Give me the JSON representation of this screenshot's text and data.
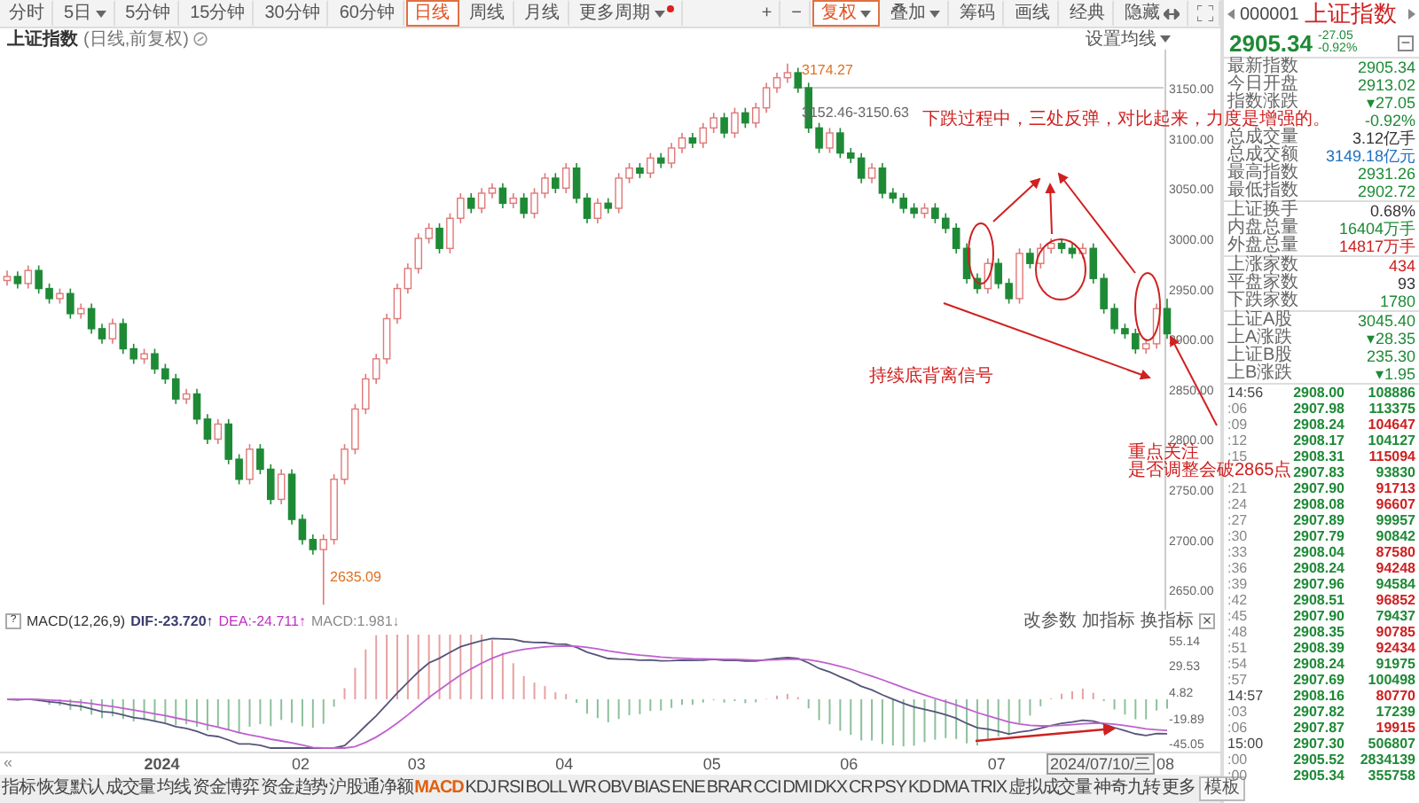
{
  "toolbar": {
    "periods": [
      {
        "label": "分时",
        "selected": false,
        "dropdown": false
      },
      {
        "label": "5日",
        "selected": false,
        "dropdown": true
      },
      {
        "label": "5分钟",
        "selected": false,
        "dropdown": false
      },
      {
        "label": "15分钟",
        "selected": false,
        "dropdown": false
      },
      {
        "label": "30分钟",
        "selected": false,
        "dropdown": false
      },
      {
        "label": "60分钟",
        "selected": false,
        "dropdown": false
      },
      {
        "label": "日线",
        "selected": true,
        "dropdown": false
      },
      {
        "label": "周线",
        "selected": false,
        "dropdown": false
      },
      {
        "label": "月线",
        "selected": false,
        "dropdown": false
      },
      {
        "label": "更多周期",
        "selected": false,
        "dropdown": true,
        "badge": true
      }
    ],
    "tools": [
      {
        "label": "+",
        "kind": "text",
        "selected": false
      },
      {
        "label": "−",
        "kind": "text",
        "selected": false
      },
      {
        "label": "复权",
        "kind": "dropdown",
        "selected": true
      },
      {
        "label": "叠加",
        "kind": "dropdown",
        "selected": false
      },
      {
        "label": "筹码",
        "kind": "text",
        "selected": false
      },
      {
        "label": "画线",
        "kind": "text",
        "selected": false
      },
      {
        "label": "经典",
        "kind": "text",
        "selected": false
      },
      {
        "label": "隐藏",
        "kind": "hide",
        "selected": false
      },
      {
        "kind": "fullscreen",
        "selected": false
      }
    ]
  },
  "chart": {
    "title": "上证指数",
    "subtitle": "(日线,前复权)",
    "ma_settings": "设置均线",
    "high_label": "3174.27",
    "range_label": "3152.46-3150.63",
    "low_label": "2635.09",
    "annotations": [
      "下跌过程中，三处反弹，对比起来，力度是增强的。",
      "持续底背离信号",
      "重点关注",
      "是否调整会破2865点"
    ],
    "chart_data": {
      "type": "candlestick",
      "ylim": [
        2630,
        3188
      ],
      "ohlc": [
        [
          2958,
          2968,
          2953,
          2962
        ],
        [
          2962,
          2967,
          2950,
          2955
        ],
        [
          2955,
          2973,
          2950,
          2968
        ],
        [
          2968,
          2973,
          2945,
          2950
        ],
        [
          2950,
          2955,
          2935,
          2940
        ],
        [
          2940,
          2950,
          2935,
          2945
        ],
        [
          2945,
          2950,
          2920,
          2925
        ],
        [
          2925,
          2935,
          2920,
          2930
        ],
        [
          2930,
          2935,
          2905,
          2910
        ],
        [
          2910,
          2915,
          2895,
          2900
        ],
        [
          2900,
          2920,
          2895,
          2915
        ],
        [
          2915,
          2920,
          2885,
          2890
        ],
        [
          2890,
          2895,
          2875,
          2880
        ],
        [
          2880,
          2890,
          2875,
          2885
        ],
        [
          2885,
          2890,
          2865,
          2870
        ],
        [
          2870,
          2875,
          2855,
          2860
        ],
        [
          2860,
          2865,
          2835,
          2840
        ],
        [
          2840,
          2850,
          2835,
          2845
        ],
        [
          2845,
          2850,
          2815,
          2820
        ],
        [
          2820,
          2825,
          2795,
          2800
        ],
        [
          2800,
          2820,
          2795,
          2815
        ],
        [
          2815,
          2820,
          2775,
          2780
        ],
        [
          2780,
          2785,
          2755,
          2760
        ],
        [
          2760,
          2795,
          2755,
          2790
        ],
        [
          2790,
          2795,
          2765,
          2770
        ],
        [
          2770,
          2775,
          2735,
          2740
        ],
        [
          2740,
          2770,
          2735,
          2765
        ],
        [
          2765,
          2770,
          2715,
          2720
        ],
        [
          2720,
          2725,
          2695,
          2700
        ],
        [
          2700,
          2705,
          2685,
          2690
        ],
        [
          2690,
          2705,
          2635,
          2700
        ],
        [
          2700,
          2765,
          2695,
          2760
        ],
        [
          2760,
          2795,
          2755,
          2790
        ],
        [
          2790,
          2835,
          2785,
          2830
        ],
        [
          2830,
          2865,
          2825,
          2860
        ],
        [
          2860,
          2885,
          2855,
          2880
        ],
        [
          2880,
          2925,
          2875,
          2920
        ],
        [
          2920,
          2955,
          2915,
          2950
        ],
        [
          2950,
          2975,
          2945,
          2970
        ],
        [
          2970,
          3005,
          2965,
          3000
        ],
        [
          3000,
          3015,
          2995,
          3010
        ],
        [
          3010,
          3015,
          2985,
          2990
        ],
        [
          2990,
          3025,
          2985,
          3020
        ],
        [
          3020,
          3045,
          3015,
          3040
        ],
        [
          3040,
          3045,
          3025,
          3030
        ],
        [
          3030,
          3050,
          3025,
          3045
        ],
        [
          3045,
          3055,
          3040,
          3050
        ],
        [
          3050,
          3055,
          3030,
          3035
        ],
        [
          3035,
          3045,
          3030,
          3040
        ],
        [
          3040,
          3045,
          3020,
          3025
        ],
        [
          3025,
          3050,
          3020,
          3045
        ],
        [
          3045,
          3065,
          3040,
          3060
        ],
        [
          3060,
          3065,
          3045,
          3050
        ],
        [
          3050,
          3075,
          3045,
          3070
        ],
        [
          3070,
          3075,
          3035,
          3040
        ],
        [
          3040,
          3045,
          3015,
          3020
        ],
        [
          3020,
          3040,
          3015,
          3035
        ],
        [
          3035,
          3040,
          3025,
          3030
        ],
        [
          3030,
          3065,
          3025,
          3060
        ],
        [
          3060,
          3075,
          3055,
          3070
        ],
        [
          3070,
          3075,
          3060,
          3065
        ],
        [
          3065,
          3085,
          3060,
          3080
        ],
        [
          3080,
          3085,
          3070,
          3075
        ],
        [
          3075,
          3095,
          3070,
          3090
        ],
        [
          3090,
          3105,
          3085,
          3100
        ],
        [
          3100,
          3105,
          3090,
          3095
        ],
        [
          3095,
          3115,
          3090,
          3110
        ],
        [
          3110,
          3125,
          3105,
          3120
        ],
        [
          3120,
          3125,
          3100,
          3105
        ],
        [
          3105,
          3130,
          3100,
          3125
        ],
        [
          3125,
          3130,
          3110,
          3115
        ],
        [
          3115,
          3135,
          3110,
          3130
        ],
        [
          3130,
          3155,
          3125,
          3150
        ],
        [
          3150,
          3165,
          3145,
          3160
        ],
        [
          3160,
          3174,
          3155,
          3165
        ],
        [
          3165,
          3170,
          3145,
          3150
        ],
        [
          3150,
          3155,
          3105,
          3110
        ],
        [
          3110,
          3115,
          3085,
          3090
        ],
        [
          3090,
          3110,
          3085,
          3105
        ],
        [
          3105,
          3110,
          3080,
          3085
        ],
        [
          3085,
          3090,
          3075,
          3080
        ],
        [
          3080,
          3085,
          3055,
          3060
        ],
        [
          3060,
          3075,
          3055,
          3070
        ],
        [
          3070,
          3075,
          3040,
          3045
        ],
        [
          3045,
          3050,
          3035,
          3040
        ],
        [
          3040,
          3045,
          3025,
          3030
        ],
        [
          3030,
          3035,
          3020,
          3025
        ],
        [
          3025,
          3035,
          3020,
          3030
        ],
        [
          3030,
          3035,
          3015,
          3020
        ],
        [
          3020,
          3025,
          3005,
          3010
        ],
        [
          3010,
          3015,
          2985,
          2990
        ],
        [
          2990,
          2995,
          2955,
          2960
        ],
        [
          2960,
          2965,
          2945,
          2950
        ],
        [
          2950,
          2980,
          2945,
          2975
        ],
        [
          2975,
          2980,
          2950,
          2955
        ],
        [
          2955,
          2960,
          2935,
          2940
        ],
        [
          2940,
          2990,
          2935,
          2985
        ],
        [
          2985,
          2990,
          2970,
          2975
        ],
        [
          2975,
          2995,
          2970,
          2990
        ],
        [
          2990,
          3000,
          2985,
          2995
        ],
        [
          2995,
          3000,
          2985,
          2990
        ],
        [
          2990,
          2995,
          2980,
          2985
        ],
        [
          2985,
          2995,
          2980,
          2990
        ],
        [
          2990,
          2995,
          2955,
          2960
        ],
        [
          2960,
          2965,
          2925,
          2930
        ],
        [
          2930,
          2935,
          2905,
          2910
        ],
        [
          2910,
          2915,
          2900,
          2905
        ],
        [
          2905,
          2910,
          2885,
          2890
        ],
        [
          2890,
          2900,
          2885,
          2895
        ],
        [
          2895,
          2935,
          2890,
          2930
        ],
        [
          2930,
          2940,
          2900,
          2905
        ]
      ],
      "yticks": [
        {
          "value": 3150,
          "label": "3150.00"
        },
        {
          "value": 3100,
          "label": "3100.00"
        },
        {
          "value": 3050,
          "label": "3050.00"
        },
        {
          "value": 3000,
          "label": "3000.00"
        },
        {
          "value": 2950,
          "label": "2950.00"
        },
        {
          "value": 2900,
          "label": "2900.00"
        },
        {
          "value": 2850,
          "label": "2850.00"
        },
        {
          "value": 2800,
          "label": "2800.00"
        },
        {
          "value": 2750,
          "label": "2750.00"
        },
        {
          "value": 2700,
          "label": "2700.00"
        },
        {
          "value": 2650,
          "label": "2650.00"
        }
      ]
    }
  },
  "macd": {
    "help": "?",
    "name": "MACD(12,26,9)",
    "dif": "DIF:-23.720↑",
    "dea": "DEA:-24.711↑",
    "value": "MACD:1.981↓",
    "actions": [
      "改参数",
      "加指标",
      "换指标"
    ],
    "close": "×",
    "yticks": [
      "55.14",
      "29.53",
      "4.82",
      "-19.89",
      "-45.05"
    ]
  },
  "axis": {
    "scroll": "«",
    "labels": [
      "2024",
      "02",
      "03",
      "04",
      "05",
      "06",
      "07",
      "08"
    ],
    "cursor": "2024/07/10/三"
  },
  "indicator_tabs": [
    {
      "label": "指标",
      "selected": false
    },
    {
      "label": "恢复默认",
      "selected": false
    },
    {
      "label": "成交量",
      "selected": false
    },
    {
      "label": "均线",
      "selected": false
    },
    {
      "label": "资金博弈",
      "selected": false
    },
    {
      "label": "资金趋势",
      "selected": false
    },
    {
      "label": "沪股通净额",
      "selected": false
    },
    {
      "label": "MACD",
      "selected": true
    },
    {
      "label": "KDJ",
      "selected": false
    },
    {
      "label": "RSI",
      "selected": false
    },
    {
      "label": "BOLL",
      "selected": false
    },
    {
      "label": "WR",
      "selected": false
    },
    {
      "label": "OBV",
      "selected": false
    },
    {
      "label": "BIAS",
      "selected": false
    },
    {
      "label": "ENE",
      "selected": false
    },
    {
      "label": "BRAR",
      "selected": false
    },
    {
      "label": "CCI",
      "selected": false
    },
    {
      "label": "DMI",
      "selected": false
    },
    {
      "label": "DKX",
      "selected": false
    },
    {
      "label": "CR",
      "selected": false
    },
    {
      "label": "PSY",
      "selected": false
    },
    {
      "label": "KD",
      "selected": false
    },
    {
      "label": "DMA",
      "selected": false
    },
    {
      "label": "TRIX",
      "selected": false
    },
    {
      "label": "虚拟成交量",
      "selected": false
    },
    {
      "label": "神奇九转",
      "selected": false
    },
    {
      "label": "更多",
      "selected": false
    }
  ],
  "template_button": "模板",
  "quote": {
    "code": "000001",
    "name": "上证指数",
    "price": "2905.34",
    "change": "-27.05",
    "change_pct": "-0.92%",
    "collapse": "−",
    "stats": [
      [
        {
          "label": "最新指数",
          "value": "2905.34",
          "color": "#1e8a36"
        },
        {
          "label": "今日开盘",
          "value": "2913.02",
          "color": "#1e8a36"
        },
        {
          "label": "指数涨跌",
          "value": "▾27.05",
          "color": "#1e8a36"
        },
        {
          "value": "-0.92%",
          "color": "#1e8a36"
        },
        {
          "label": "总成交量",
          "value": "3.12亿手",
          "color": "#333333"
        },
        {
          "label": "总成交额",
          "value": "3149.18亿元",
          "color": "#2070c0"
        },
        {
          "label": "最高指数",
          "value": "2931.26",
          "color": "#1e8a36"
        },
        {
          "label": "最低指数",
          "value": "2902.72",
          "color": "#1e8a36"
        }
      ],
      [
        {
          "label": "上证换手",
          "value": "0.68%",
          "color": "#333333"
        },
        {
          "label": "内盘总量",
          "value": "16404万手",
          "color": "#1e8a36"
        },
        {
          "label": "外盘总量",
          "value": "14817万手",
          "color": "#d02020"
        }
      ],
      [
        {
          "label": "上涨家数",
          "value": "434",
          "color": "#d02020"
        },
        {
          "label": "平盘家数",
          "value": "93",
          "color": "#333333"
        },
        {
          "label": "下跌家数",
          "value": "1780",
          "color": "#1e8a36"
        }
      ],
      [
        {
          "label": "上证A股",
          "value": "3045.40",
          "color": "#1e8a36"
        },
        {
          "label": "上A涨跌",
          "value": "▾28.35",
          "color": "#1e8a36"
        },
        {
          "label": "上证B股",
          "value": "235.30",
          "color": "#1e8a36"
        },
        {
          "label": "上B涨跌",
          "value": "▾1.95",
          "color": "#1e8a36"
        }
      ]
    ],
    "ticks": [
      {
        "time": "14:56",
        "price": "2908.00",
        "volume": "108886",
        "color": "#1e8a36"
      },
      {
        "time": ":06",
        "price": "2907.98",
        "volume": "113375",
        "color": "#1e8a36"
      },
      {
        "time": ":09",
        "price": "2908.24",
        "volume": "104647",
        "color": "#d02020"
      },
      {
        "time": ":12",
        "price": "2908.17",
        "volume": "104127",
        "color": "#1e8a36"
      },
      {
        "time": ":15",
        "price": "2908.31",
        "volume": "115094",
        "color": "#d02020"
      },
      {
        "price": "2907.83",
        "volume": "93830",
        "color": "#1e8a36"
      },
      {
        "time": ":21",
        "price": "2907.90",
        "volume": "91713",
        "color": "#d02020"
      },
      {
        "time": ":24",
        "price": "2908.08",
        "volume": "96607",
        "color": "#d02020"
      },
      {
        "time": ":27",
        "price": "2907.89",
        "volume": "99957",
        "color": "#1e8a36"
      },
      {
        "time": ":30",
        "price": "2907.79",
        "volume": "90842",
        "color": "#1e8a36"
      },
      {
        "time": ":33",
        "price": "2908.04",
        "volume": "87580",
        "color": "#d02020"
      },
      {
        "time": ":36",
        "price": "2908.24",
        "volume": "94248",
        "color": "#d02020"
      },
      {
        "time": ":39",
        "price": "2907.96",
        "volume": "94584",
        "color": "#1e8a36"
      },
      {
        "time": ":42",
        "price": "2908.51",
        "volume": "96852",
        "color": "#d02020"
      },
      {
        "time": ":45",
        "price": "2907.90",
        "volume": "79437",
        "color": "#1e8a36"
      },
      {
        "time": ":48",
        "price": "2908.35",
        "volume": "90785",
        "color": "#d02020"
      },
      {
        "time": ":51",
        "price": "2908.39",
        "volume": "92434",
        "color": "#d02020"
      },
      {
        "time": ":54",
        "price": "2908.24",
        "volume": "91975",
        "color": "#1e8a36"
      },
      {
        "time": ":57",
        "price": "2907.69",
        "volume": "100498",
        "color": "#1e8a36"
      },
      {
        "time": "14:57",
        "price": "2908.16",
        "volume": "80770",
        "color": "#d02020"
      },
      {
        "time": ":03",
        "price": "2907.82",
        "volume": "17239",
        "color": "#1e8a36"
      },
      {
        "time": ":06",
        "price": "2907.87",
        "volume": "19915",
        "color": "#d02020"
      },
      {
        "time": "15:00",
        "price": "2907.30",
        "volume": "506807",
        "color": "#1e8a36"
      },
      {
        "time": ":00",
        "price": "2905.52",
        "volume": "2834139",
        "color": "#1e8a36"
      },
      {
        "time": ":00",
        "price": "2905.34",
        "volume": "355758",
        "color": "#1e8a36"
      }
    ]
  }
}
